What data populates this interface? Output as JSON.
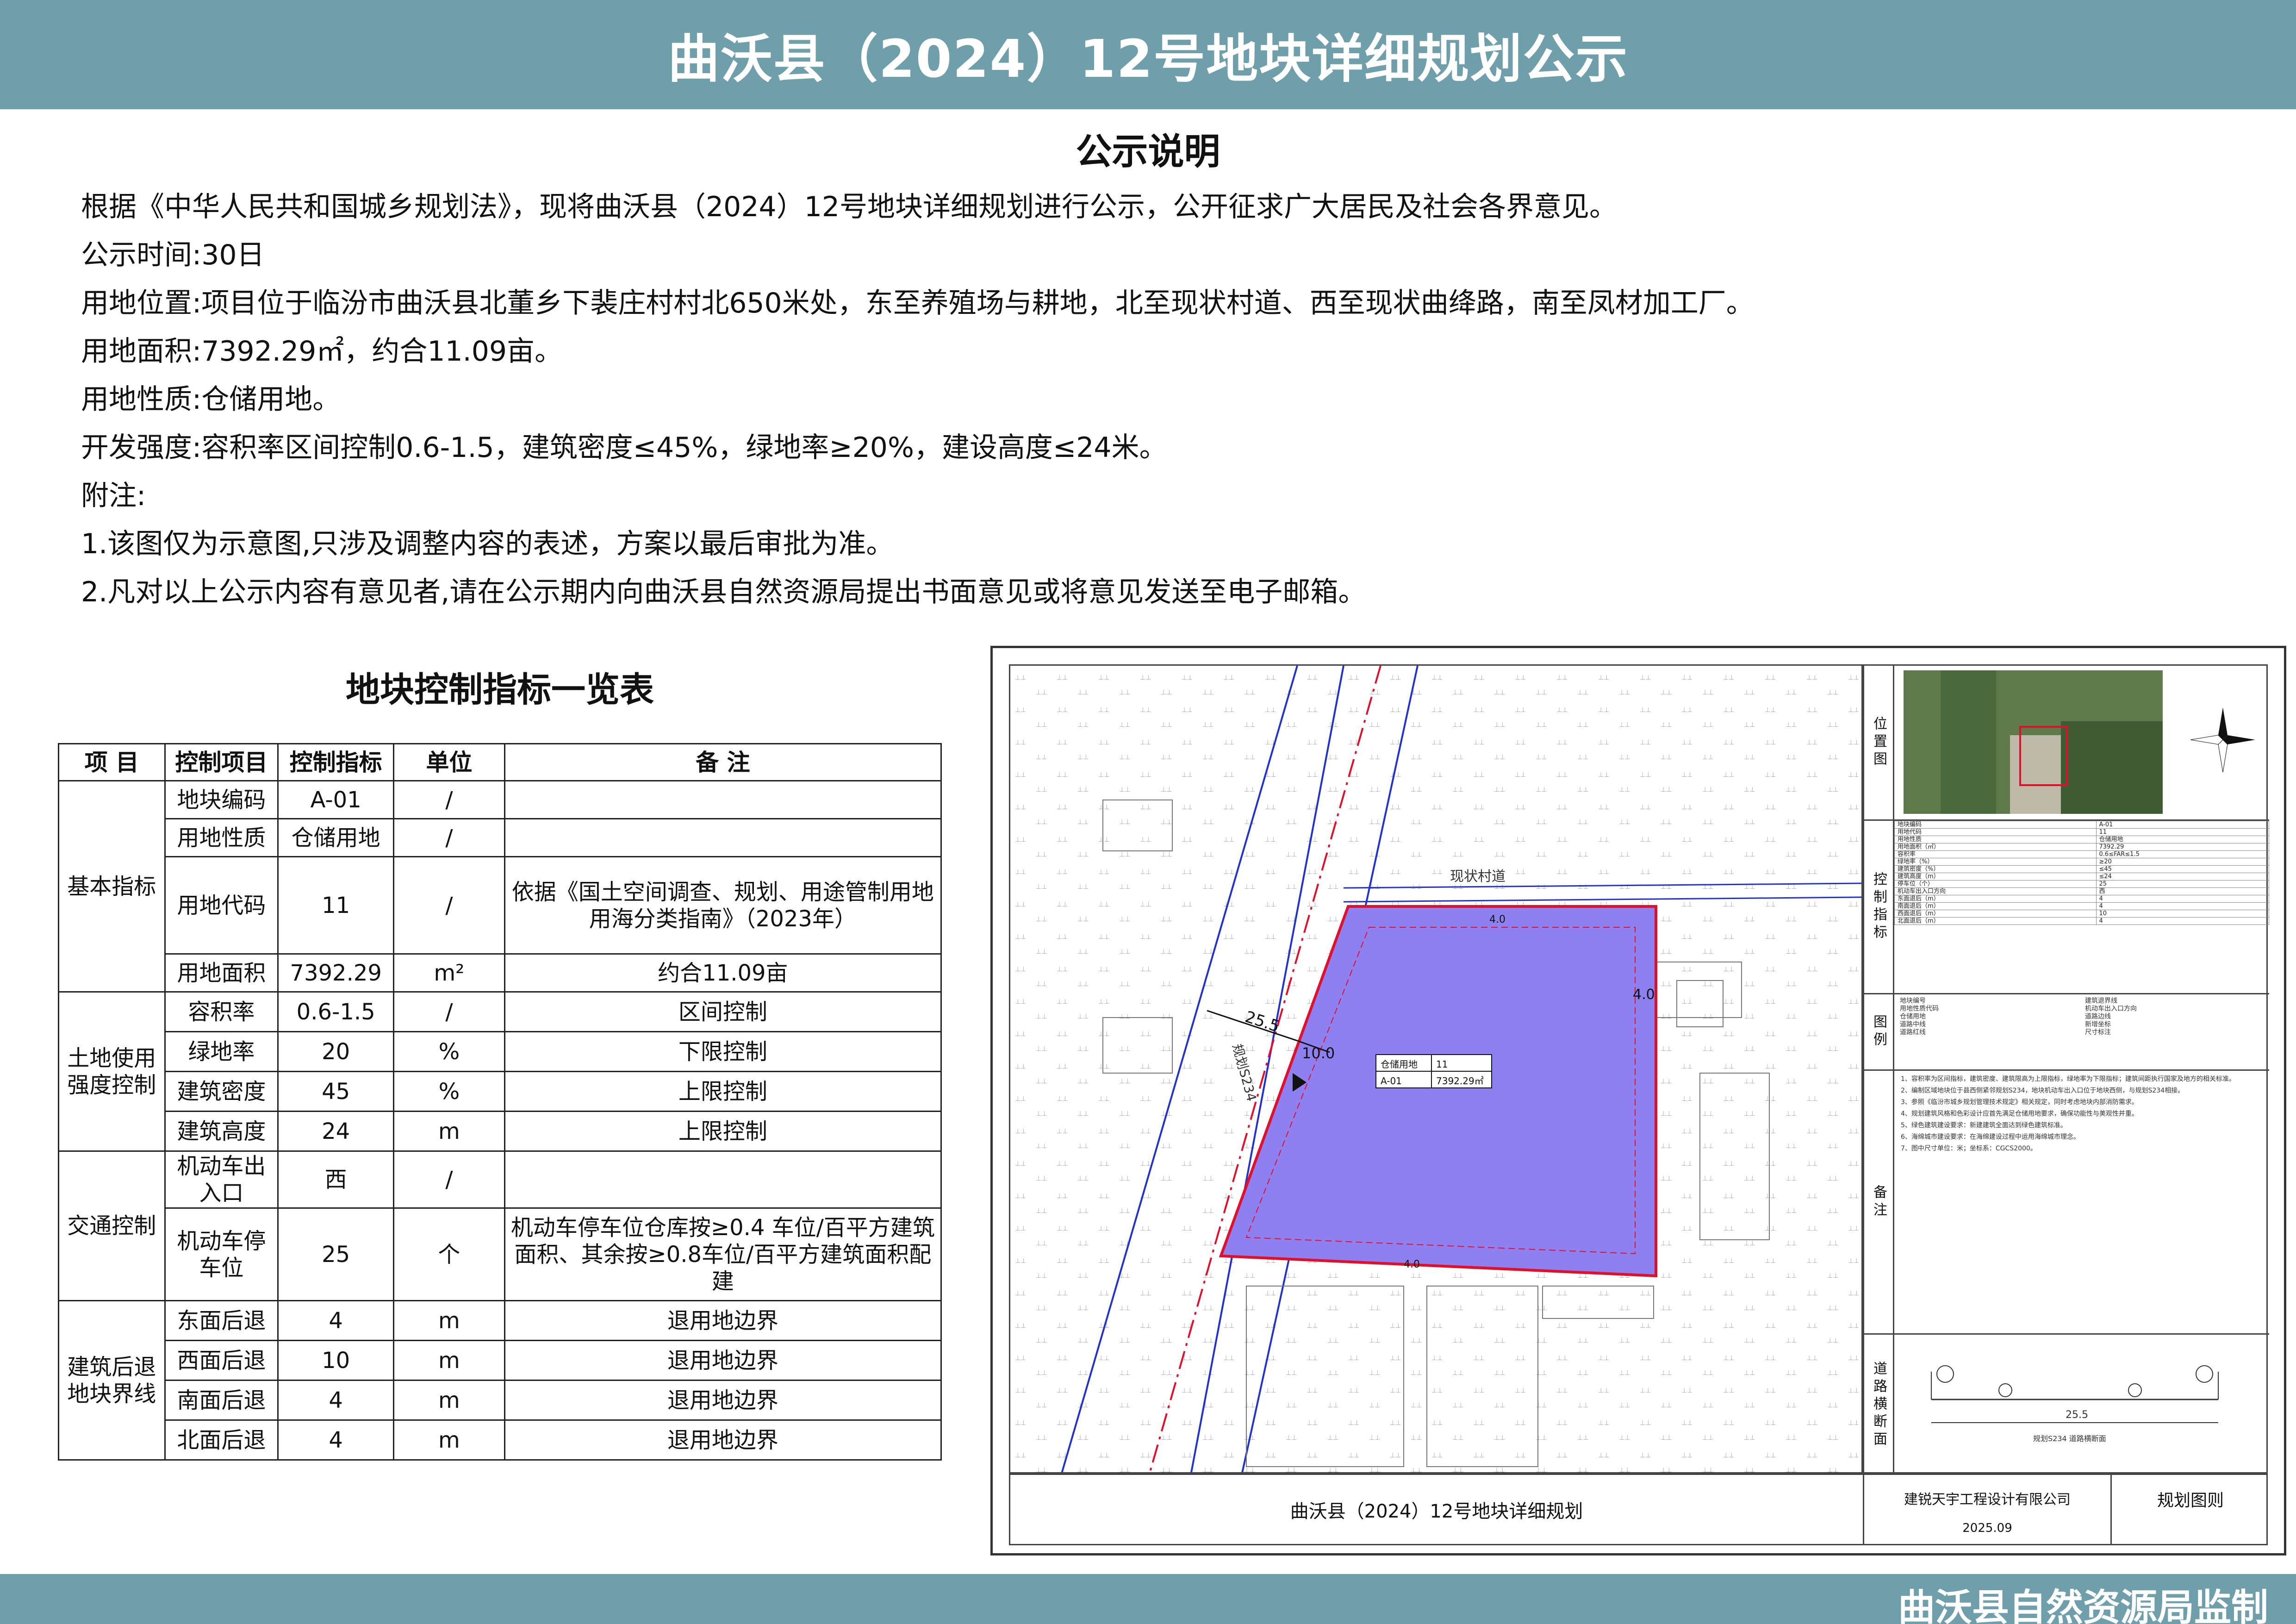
{
  "header": {
    "title": "曲沃县（2024）12号地块详细规划公示"
  },
  "notice": {
    "title": "公示说明",
    "lines": [
      "根据《中华人民共和国城乡规划法》，现将曲沃县（2024）12号地块详细规划进行公示，公开征求广大居民及社会各界意见。",
      "公示时间:30日",
      "用地位置:项目位于临汾市曲沃县北董乡下裴庄村村北650米处，东至养殖场与耕地，北至现状村道、西至现状曲绛路，南至凤材加工厂。",
      "用地面积:7392.29㎡，约合11.09亩。",
      "用地性质:仓储用地。",
      "开发强度:容积率区间控制0.6-1.5，建筑密度≤45%，绿地率≥20%，建设高度≤24米。",
      "附注:",
      "1.该图仅为示意图,只涉及调整内容的表述，方案以最后审批为准。",
      "2.凡对以上公示内容有意见者,请在公示期内向曲沃县自然资源局提出书面意见或将意见发送至电子邮箱。"
    ]
  },
  "indicator_table": {
    "title": "地块控制指标一览表",
    "headers": [
      "项 目",
      "控制项目",
      "控制指标",
      "单位",
      "备 注"
    ],
    "groups": [
      {
        "name": "基本指标",
        "rows": [
          [
            "地块编码",
            "A-01",
            "/",
            ""
          ],
          [
            "用地性质",
            "仓储用地",
            "/",
            ""
          ],
          [
            "用地代码",
            "11",
            "/",
            "依据《国土空间调查、规划、用途管制用地用海分类指南》（2023年）"
          ],
          [
            "用地面积",
            "7392.29",
            "m²",
            "约合11.09亩"
          ]
        ]
      },
      {
        "name": "土地使用强度控制",
        "rows": [
          [
            "容积率",
            "0.6-1.5",
            "/",
            "区间控制"
          ],
          [
            "绿地率",
            "20",
            "%",
            "下限控制"
          ],
          [
            "建筑密度",
            "45",
            "%",
            "上限控制"
          ],
          [
            "建筑高度",
            "24",
            "m",
            "上限控制"
          ]
        ]
      },
      {
        "name": "交通控制",
        "rows": [
          [
            "机动车出入口",
            "西",
            "/",
            ""
          ],
          [
            "机动车停车位",
            "25",
            "个",
            "机动车停车位仓库按≥0.4 车位/百平方建筑面积、其余按≥0.8车位/百平方建筑面积配建"
          ]
        ]
      },
      {
        "name": "建筑后退地块界线",
        "rows": [
          [
            "东面后退",
            "4",
            "m",
            "退用地边界"
          ],
          [
            "西面后退",
            "10",
            "m",
            "退用地边界"
          ],
          [
            "南面后退",
            "4",
            "m",
            "退用地边界"
          ],
          [
            "北面后退",
            "4",
            "m",
            "退用地边界"
          ]
        ]
      }
    ]
  },
  "drawing": {
    "map": {
      "road_label_north": "现状村道",
      "road_label_west": "规划S234",
      "dim_road_width": "25.5",
      "dim_setback_west": "10.0",
      "dim_setback_east": "4.0",
      "dim_setback_north": "4.0",
      "dim_setback_south": "4.0",
      "parcel_label": {
        "use": "仓储用地",
        "code": "11",
        "id": "A-01",
        "area": "7392.29㎡"
      },
      "parcel_fill": "#8e80f0",
      "boundary_color": "#e0102a",
      "road_line_color": "#2233cc"
    },
    "panel": {
      "location_label": "位置图",
      "control_label": "控制指标",
      "legend_label": "图例",
      "notes_label": "备注",
      "section_label": "道路横断面",
      "control_rows": [
        [
          "地块编码",
          "A-01"
        ],
        [
          "用地代码",
          "11"
        ],
        [
          "用地性质",
          "仓储用地"
        ],
        [
          "用地面积（㎡）",
          "7392.29"
        ],
        [
          "容积率",
          "0.6≤FAR≤1.5"
        ],
        [
          "绿地率（%）",
          "≥20"
        ],
        [
          "建筑密度（%）",
          "≤45"
        ],
        [
          "建筑高度（m）",
          "≤24"
        ],
        [
          "停车位（个）",
          "25"
        ],
        [
          "机动车出入口方向",
          "西"
        ],
        [
          "东面退后（m）",
          "4"
        ],
        [
          "南面退后（m）",
          "4"
        ],
        [
          "西面退后（m）",
          "10"
        ],
        [
          "北面退后（m）",
          "4"
        ]
      ],
      "legend_items": [
        "地块编号",
        "用地性质代码",
        "仓储用地",
        "道路中线",
        "道路红线",
        "建筑退界线",
        "机动车出入口方向",
        "道路边线",
        "新增坐标",
        "尺寸标注"
      ],
      "notes": [
        "1、容积率为区间指标，建筑密度、建筑限高为上限指标，绿地率为下限指标；建筑间距执行国家及地方的相关标准。",
        "2、编制区域地块位于县西侧紧邻规划S234，地块机动车出入口位于地块西侧，与规划S234相接。",
        "3、参照《临汾市城乡规划管理技术规定》相关规定，同时考虑地块内部消防需求。",
        "4、规划建筑风格和色彩设计应首先满足仓储用地要求，确保功能性与美观性并重。",
        "5、绿色建筑建设要求：新建建筑全面达到绿色建筑标准。",
        "6、海绵城市建设要求：在海绵建设过程中运用海绵城市理念。",
        "7、图中尺寸单位：米；坐标系：CGCS2000。"
      ],
      "section_dim": "25.5",
      "section_caption": "规划S234 道路横断面"
    },
    "title_block": {
      "project": "曲沃县（2024）12号地块详细规划",
      "company": "建锐天宇工程设计有限公司",
      "date": "2025.09",
      "drawing_name": "规划图则"
    }
  },
  "footer": {
    "text": "曲沃县自然资源局监制"
  }
}
